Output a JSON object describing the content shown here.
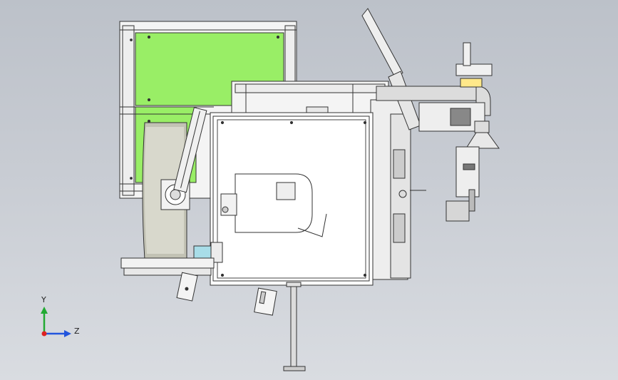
{
  "viewport": {
    "background_top": "#bcc1c9",
    "background_bottom": "#d9dce1",
    "panel_color": "#99ee66",
    "pipe_color": "#dcdcdc",
    "highlight_color": "#ffe88a",
    "cyan_block_color": "#a8dde8"
  },
  "triad": {
    "y_label": "Y",
    "z_label": "Z"
  }
}
